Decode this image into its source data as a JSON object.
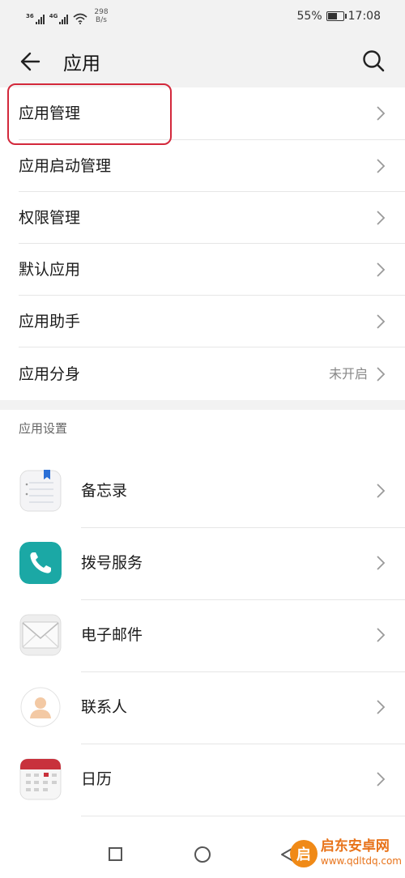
{
  "status_bar": {
    "signal1_label": "36",
    "signal2_label": "4G",
    "speed_value": "298",
    "speed_unit": "B/s",
    "battery_percent": "55%",
    "time": "17:08"
  },
  "app_bar": {
    "title": "应用",
    "back_icon": "arrow-left-icon",
    "search_icon": "search-icon"
  },
  "menu_items": [
    {
      "label": "应用管理"
    },
    {
      "label": "应用启动管理"
    },
    {
      "label": "权限管理"
    },
    {
      "label": "默认应用"
    },
    {
      "label": "应用助手"
    },
    {
      "label": "应用分身",
      "value": "未开启"
    }
  ],
  "section_title": "应用设置",
  "app_settings": [
    {
      "label": "备忘录",
      "icon": "memo-icon"
    },
    {
      "label": "拨号服务",
      "icon": "phone-icon"
    },
    {
      "label": "电子邮件",
      "icon": "email-icon"
    },
    {
      "label": "联系人",
      "icon": "contacts-icon"
    },
    {
      "label": "日历",
      "icon": "calendar-icon"
    }
  ],
  "watermark": {
    "title": "启东安卓网",
    "url": "www.qdltdq.com",
    "logo_char": "启"
  },
  "colors": {
    "highlight": "#d3283b",
    "phone_icon_bg": "#1ba8a5",
    "calendar_red": "#c8313c",
    "watermark": "#e8731a"
  }
}
